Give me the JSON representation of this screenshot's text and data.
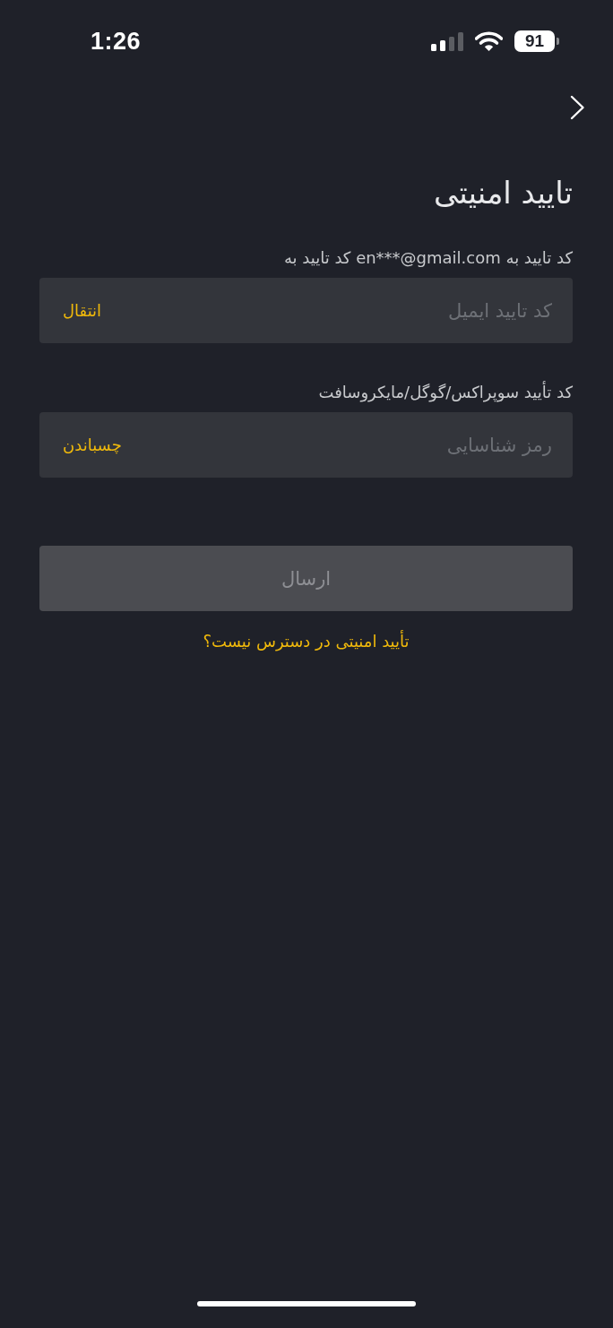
{
  "status_bar": {
    "time": "1:26",
    "battery": "91"
  },
  "title": "تایید امنیتی",
  "fields": [
    {
      "label": "کد تایید به en***@gmail.com کد تایید به",
      "placeholder": "کد تایید ایمیل",
      "action": "انتقال"
    },
    {
      "label": "کد تأیید سوپراکس/گوگل/مایکروسافت",
      "placeholder": "رمز شناسایی",
      "action": "چسباندن"
    }
  ],
  "submit_button": {
    "label": "ارسال",
    "disabled": true
  },
  "help_link": "تأیید امنیتی در دسترس نیست؟"
}
